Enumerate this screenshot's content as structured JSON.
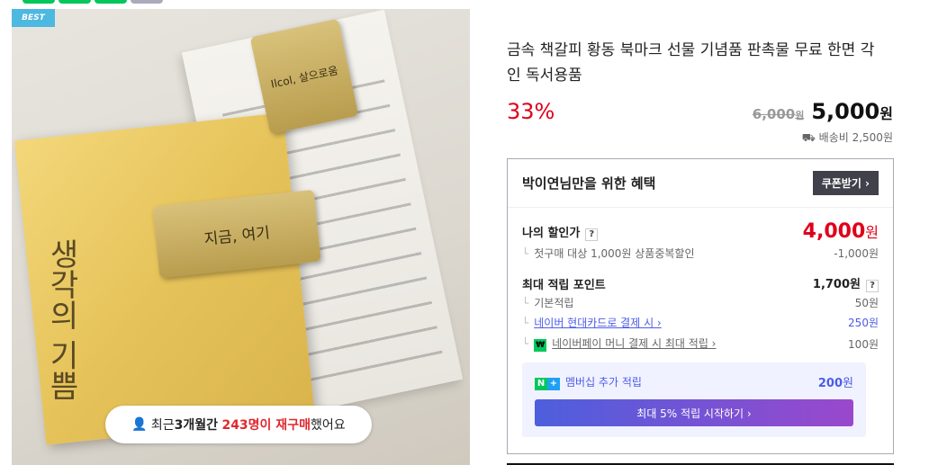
{
  "product_image": {
    "badge": "BEST",
    "book_title": "생각의 기쁨",
    "clip_text": "지금, 여기",
    "clip_text_2": "Ilcol, 살으로움",
    "repurchase": {
      "prefix": "최근 ",
      "period": "3개월간",
      "count": "243명이 재구매",
      "suffix": " 했어요"
    }
  },
  "product": {
    "title": "금속 책갈피 황동 북마크 선물 기념품 판촉물 무료 한면 각인 독서용품",
    "discount": "33%",
    "original_price": "6,000",
    "original_unit": "원",
    "price": "5,000",
    "price_unit": "원",
    "shipping": "배송비 2,500원"
  },
  "benefits": {
    "heading": "박이연님만을 위한 혜택",
    "coupon_button": "쿠폰받기 ›",
    "my_price_label": "나의 할인가",
    "my_price": "4,000",
    "my_price_unit": "원",
    "first_purchase_label": "첫구매 대상 1,000원 상품중복할인",
    "first_purchase_value": "-1,000원",
    "max_points_label": "최대 적립 포인트",
    "max_points": "1,700원",
    "basic_label": "기본적립",
    "basic_value": "50원",
    "card_label": "네이버 현대카드로 결제 시 ›",
    "card_value": "250원",
    "pay_label": "네이버페이 머니 결제 시 최대 적립 ›",
    "pay_value": "100원",
    "help": "?",
    "membership_label": "멤버십 추가 적립",
    "membership_value": "200",
    "membership_unit": "원",
    "membership_button": "최대 5% 적립 시작하기 ›"
  },
  "colors": {
    "accent": "#e0001a",
    "naver_green": "#03c75a",
    "link": "#4c5ce8"
  }
}
